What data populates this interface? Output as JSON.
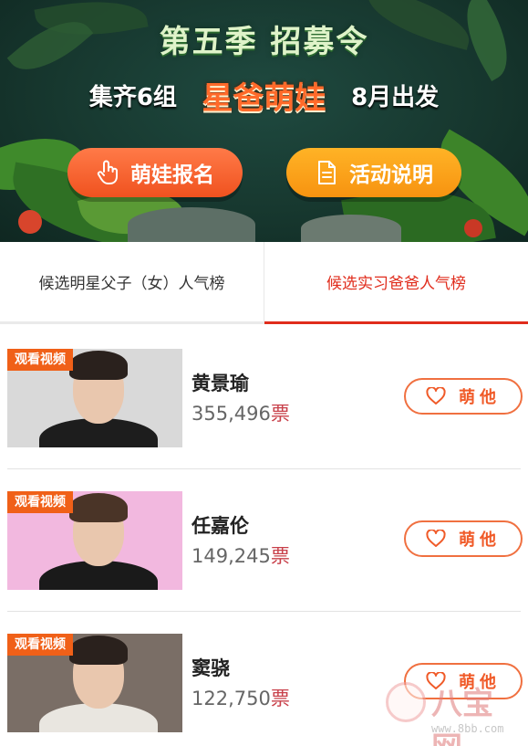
{
  "banner": {
    "season_title": "第五季 招募令",
    "headline_left": "集齐6组",
    "headline_center": "星爸萌娃",
    "headline_right": "8月出发",
    "buttons": [
      {
        "label": "萌娃报名",
        "icon": "hand-pointer-icon",
        "color": "#f2582a"
      },
      {
        "label": "活动说明",
        "icon": "document-icon",
        "color": "#f99b16"
      }
    ]
  },
  "tabs": [
    {
      "label": "候选明星父子（女）人气榜",
      "active": false
    },
    {
      "label": "候选实习爸爸人气榜",
      "active": true
    }
  ],
  "accent_color": "#e02c1c",
  "candidates": [
    {
      "badge": "观看视频",
      "name": "黄景瑜",
      "votes": "355,496",
      "unit": "票",
      "vote_label": "萌他",
      "photo_bg": "#d9d9d9",
      "outfit": "#1d1d1d"
    },
    {
      "badge": "观看视频",
      "name": "任嘉伦",
      "votes": "149,245",
      "unit": "票",
      "vote_label": "萌他",
      "photo_bg": "#f2b8df",
      "outfit": "#1a1a1a"
    },
    {
      "badge": "观看视频",
      "name": "窦骁",
      "votes": "122,750",
      "unit": "票",
      "vote_label": "萌他",
      "photo_bg": "#7a6e66",
      "outfit": "#e9e6e0"
    }
  ],
  "watermark": {
    "text": "八宝网",
    "url": "www.8bb.com"
  }
}
